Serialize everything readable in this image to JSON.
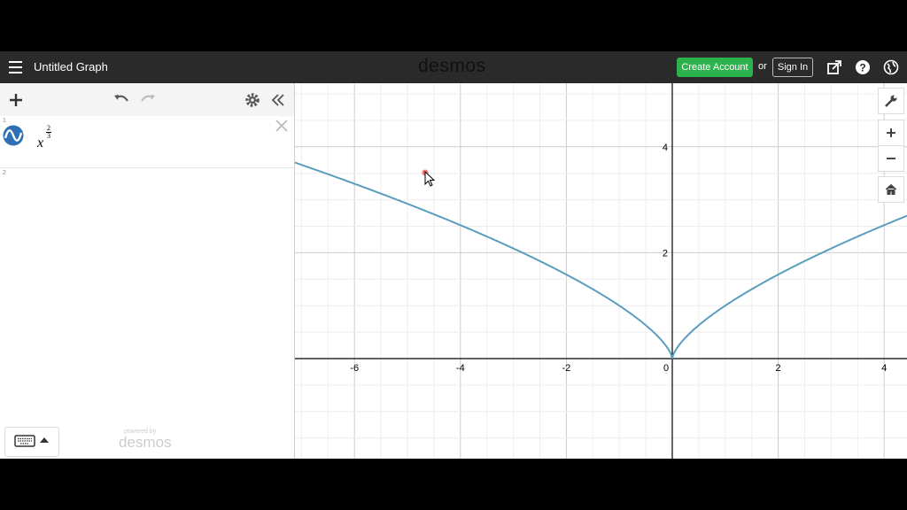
{
  "header": {
    "title": "Untitled Graph",
    "logo": "desmos",
    "create_account": "Create Account",
    "or": "or",
    "sign_in": "Sign In"
  },
  "expressions": [
    {
      "index": "1",
      "base": "x",
      "exp_num": "2",
      "exp_den": "3",
      "color": "#2d70b3"
    },
    {
      "index": "2"
    }
  ],
  "powered_by": {
    "label": "powered by",
    "logo": "desmos"
  },
  "graph": {
    "x_ticks": [
      "-6",
      "-4",
      "-2",
      "0",
      "2",
      "4"
    ],
    "y_ticks": [
      "2",
      "4"
    ],
    "curve_color": "#5b9dbe",
    "function": "x^(2/3)"
  },
  "colors": {
    "header_bg": "#2a2a2a",
    "create_btn": "#2bb24c",
    "axis": "#000000",
    "grid_major": "#cccccc",
    "grid_minor": "#eeeeee"
  }
}
